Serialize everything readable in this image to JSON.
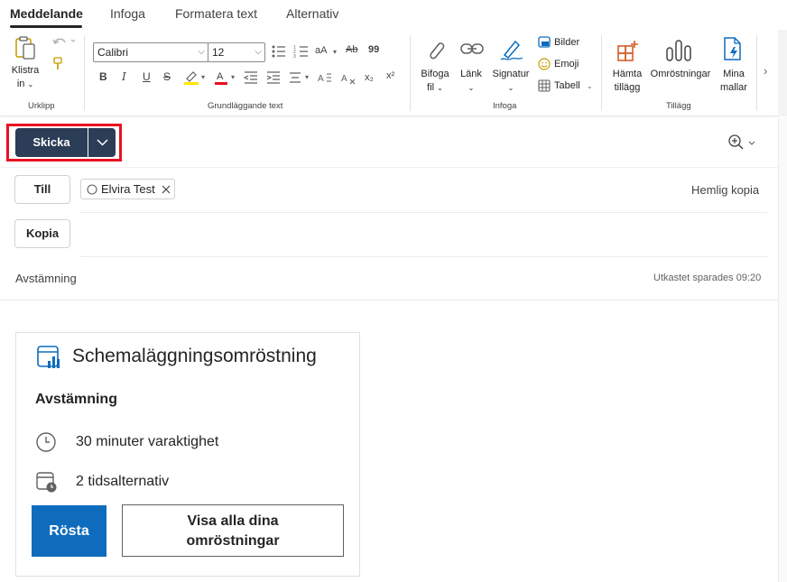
{
  "tabs": [
    "Meddelande",
    "Infoga",
    "Formatera text",
    "Alternativ"
  ],
  "ribbon": {
    "clipboard": {
      "paste_label_1": "Klistra",
      "paste_label_2": "in",
      "group": "Urklipp"
    },
    "format": {
      "font": "Calibri",
      "size": "12",
      "group": "Grundläggande text",
      "bold": "B",
      "italic": "I",
      "underline": "U",
      "strike": "S",
      "font_size_btn": "aA",
      "spell_btn": "Ab",
      "quote_btn": "99",
      "subscript": "x₂",
      "superscript": "x²"
    },
    "insert": {
      "attach_1": "Bifoga",
      "attach_2": "fil",
      "link": "Länk",
      "signature": "Signatur",
      "pictures": "Bilder",
      "emoji": "Emoji",
      "table": "Tabell",
      "group": "Infoga"
    },
    "addins": {
      "get_1": "Hämta",
      "get_2": "tillägg",
      "polls": "Omröstningar",
      "templates_1": "Mina",
      "templates_2": "mallar",
      "group": "Tillägg"
    }
  },
  "compose": {
    "send": "Skicka",
    "to": "Till",
    "cc": "Kopia",
    "bcc": "Hemlig kopia",
    "recipient": "Elvira Test",
    "subject": "Avstämning",
    "draft_status": "Utkastet sparades 09:20"
  },
  "card": {
    "title": "Schemaläggningsomröstning",
    "subtitle": "Avstämning",
    "duration": "30 minuter varaktighet",
    "options": "2 tidsalternativ",
    "vote": "Rösta",
    "view_all_1": "Visa alla dina",
    "view_all_2": "omröstningar"
  },
  "colors": {
    "send_bg": "#2b3d57",
    "highlight": "#e81123",
    "vote_bg": "#0f6cbd",
    "highlight_marker": "#ffe600",
    "font_color_marker": "#e81123",
    "addin_orange": "#d35f2a",
    "icon_blue": "#0f6cbd"
  }
}
